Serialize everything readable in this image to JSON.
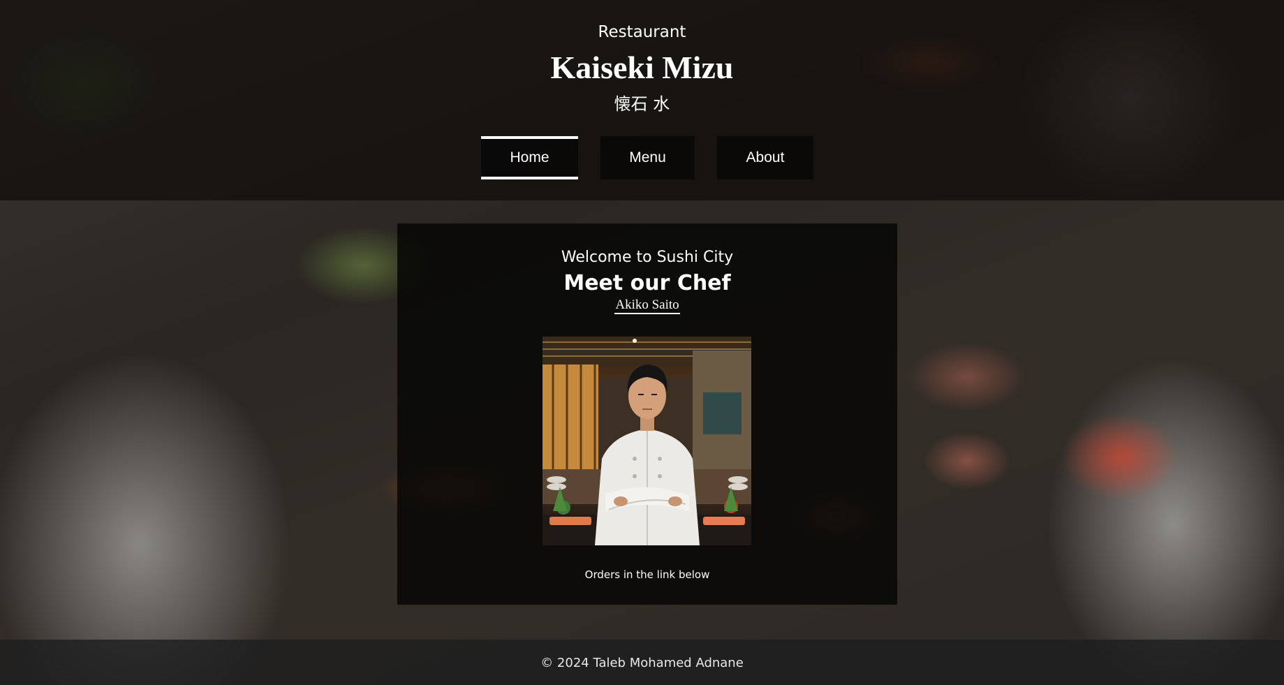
{
  "header": {
    "kicker": "Restaurant",
    "title": "Kaiseki Mizu",
    "subtitle_jp": "懐石 水"
  },
  "nav": {
    "items": [
      {
        "label": "Home",
        "active": true
      },
      {
        "label": "Menu",
        "active": false
      },
      {
        "label": "About",
        "active": false
      }
    ]
  },
  "main": {
    "welcome": "Welcome to Sushi City",
    "heading": "Meet our Chef",
    "chef_name": "Akiko Saito",
    "photo_icon": "chef-portrait-image",
    "note": "Orders in the link below"
  },
  "footer": {
    "copyright": "© 2024 Taleb Mohamed Adnane"
  },
  "colors": {
    "text": "#ffffff",
    "header_overlay": "#0f0d0b",
    "card_background": "#080807",
    "footer_background": "#1e1e20"
  }
}
